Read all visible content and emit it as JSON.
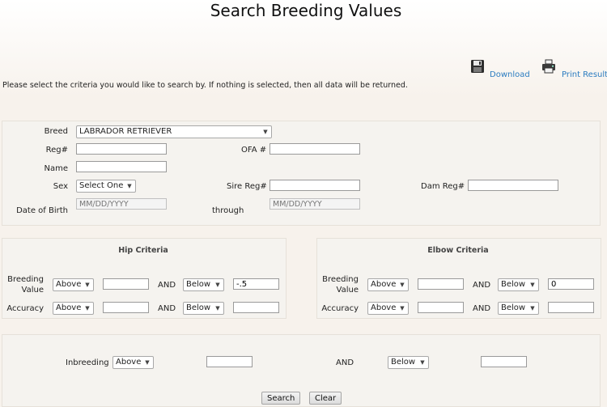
{
  "header": {
    "title": "Search Breeding Values"
  },
  "toolbar": {
    "download_label": "Download",
    "print_label": "Print Results"
  },
  "intro": "Please select the criteria you would like to search by. If nothing is selected, then all data will be returned.",
  "dog": {
    "breed_label": "Breed",
    "breed_value": "LABRADOR RETRIEVER",
    "reg_label": "Reg#",
    "reg_value": "",
    "ofa_label": "OFA #",
    "ofa_value": "",
    "name_label": "Name",
    "name_value": "",
    "sex_label": "Sex",
    "sex_value": "Select One",
    "sire_label": "Sire Reg#",
    "sire_value": "",
    "dam_label": "Dam Reg#",
    "dam_value": "",
    "dob_label": "Date of Birth",
    "dob_from_placeholder": "MM/DD/YYYY",
    "through_label": "through",
    "dob_to_placeholder": "MM/DD/YYYY"
  },
  "hip": {
    "title": "Hip Criteria",
    "bv_label_1": "Breeding",
    "bv_label_2": "Value",
    "bv_op1": "Above",
    "bv_val1": "",
    "and_label": "AND",
    "bv_op2": "Below",
    "bv_val2": "-.5",
    "acc_label": "Accuracy",
    "acc_op1": "Above",
    "acc_val1": "",
    "acc_op2": "Below",
    "acc_val2": ""
  },
  "elbow": {
    "title": "Elbow Criteria",
    "bv_label_1": "Breeding",
    "bv_label_2": "Value",
    "bv_op1": "Above",
    "bv_val1": "",
    "and_label": "AND",
    "bv_op2": "Below",
    "bv_val2": "0",
    "acc_label": "Accuracy",
    "acc_op1": "Above",
    "acc_val1": "",
    "acc_op2": "Below",
    "acc_val2": ""
  },
  "inbreeding": {
    "label": "Inbreeding",
    "op1": "Above",
    "val1": "",
    "and_label": "AND",
    "op2": "Below",
    "val2": ""
  },
  "actions": {
    "search_label": "Search",
    "clear_label": "Clear"
  },
  "icons": {
    "download": "floppy-disk-icon",
    "print": "printer-icon",
    "dropdown": "chevron-down-icon"
  }
}
